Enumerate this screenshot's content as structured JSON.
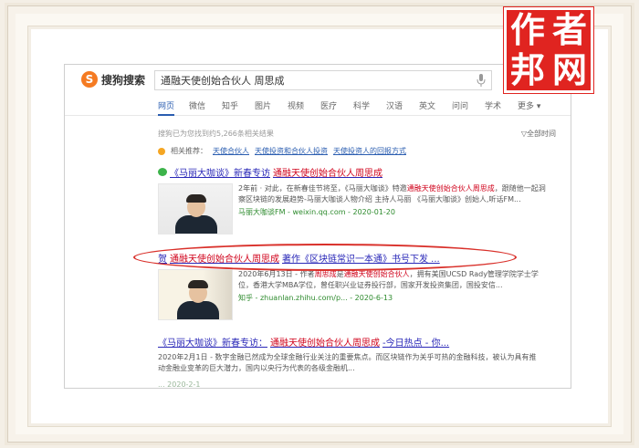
{
  "watermark": {
    "chars": [
      "作",
      "者",
      "邦",
      "网"
    ]
  },
  "header": {
    "brand_mark": "S",
    "brand_text": "搜狗搜索",
    "query": "通融天使创始合伙人 周思成"
  },
  "tabs": [
    {
      "label": "网页",
      "active": true
    },
    {
      "label": "微信"
    },
    {
      "label": "知乎"
    },
    {
      "label": "图片"
    },
    {
      "label": "视频"
    },
    {
      "label": "医疗"
    },
    {
      "label": "科学"
    },
    {
      "label": "汉语"
    },
    {
      "label": "英文"
    },
    {
      "label": "问问"
    },
    {
      "label": "学术"
    },
    {
      "label": "更多 ▾"
    }
  ],
  "results_count": "搜狗已为您找到约5,266条相关结果",
  "all_time": "▽全部时间",
  "related": {
    "label": "相关推荐：",
    "items": [
      "天使合伙人",
      "天使投资和合伙人投资",
      "天使投资人的回报方式"
    ]
  },
  "results": [
    {
      "title_pre": "《马丽大咖谈》新春专访 ",
      "title_hl": "通融天使创始合伙人周思成",
      "snippet_pre": "2年前 · 对此，在新春佳节将至，《马丽大咖谈》特邀",
      "snippet_hl1": "通融天使创始合伙人周思成",
      "snippet_post": "，跟随他一起洞察区块链的发展趋势-马丽大咖谈人物介绍 主持人马丽 《马丽大咖谈》创始人,听话FM...",
      "source": "马丽大咖谈FM - weixin.qq.com - 2020-01-20"
    },
    {
      "title_pre": "贺",
      "title_hl": "通融天使创始合伙人周思成",
      "title_post": "著作《区块链常识一本通》书号下发 ...",
      "snippet_pre": "2020年6月13日 - 作者",
      "snippet_hl1": "周思成",
      "snippet_mid": "是",
      "snippet_hl2": "通融天使创始合伙人",
      "snippet_post": "，拥有美国UCSD Rady管理学院学士学位，香港大学MBA学位，曾任职兴业证券投行部，国家开发投资集团，国投安信...",
      "source": "知乎 - zhuanlan.zhihu.com/p... - 2020-6-13"
    },
    {
      "title_pre": "《马丽大咖谈》新春专访：",
      "title_hl": "通融天使创始合伙人周思成",
      "title_post": "-今日热点 - 你...",
      "snippet": "2020年2月1日 - 数字金融已然成为全球金融行业关注的重要焦点。而区块链作为关乎可热的金融科技，被认为具有推动金融业变革的巨大潜力，国内以央行为代表的各级金融机...",
      "source_faded": "... 2020-2-1"
    }
  ]
}
